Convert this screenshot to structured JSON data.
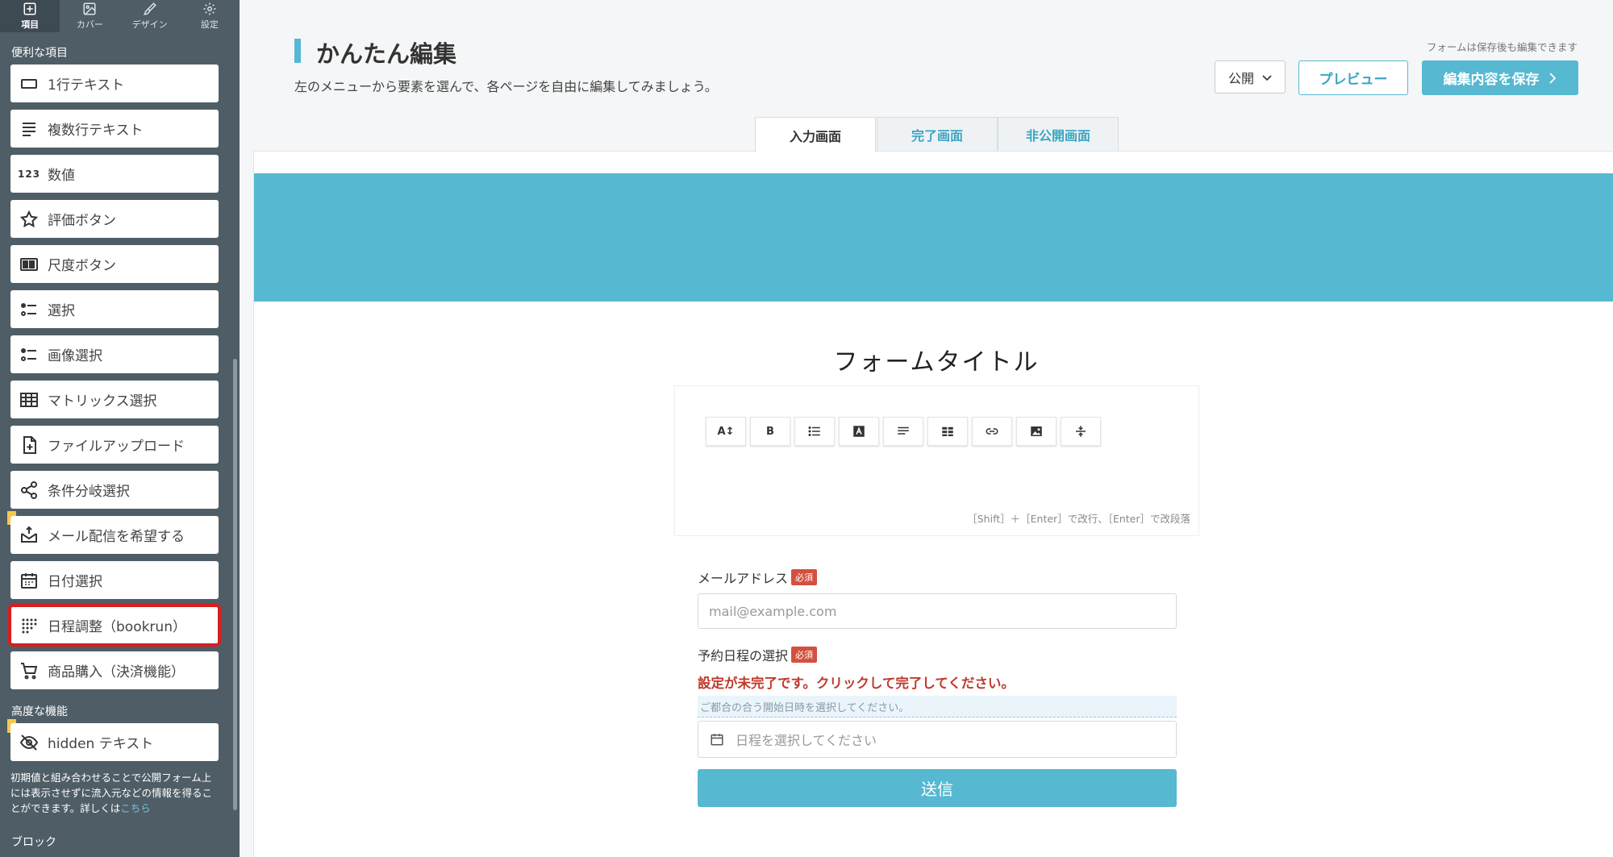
{
  "sidebar": {
    "tabs": [
      {
        "label": "項目",
        "icon": "plus-square-icon"
      },
      {
        "label": "カバー",
        "icon": "image-icon"
      },
      {
        "label": "デザイン",
        "icon": "brush-icon"
      },
      {
        "label": "設定",
        "icon": "gear-icon"
      }
    ],
    "section_convenient": "便利な項目",
    "items": [
      {
        "label": "1行テキスト",
        "icon": "single-line-icon"
      },
      {
        "label": "複数行テキスト",
        "icon": "multi-line-icon"
      },
      {
        "label": "数値",
        "icon": "number-icon",
        "icon_text": "123"
      },
      {
        "label": "評価ボタン",
        "icon": "star-icon"
      },
      {
        "label": "尺度ボタン",
        "icon": "scale-icon"
      },
      {
        "label": "選択",
        "icon": "list-select-icon"
      },
      {
        "label": "画像選択",
        "icon": "image-select-icon"
      },
      {
        "label": "マトリックス選択",
        "icon": "table-icon"
      },
      {
        "label": "ファイルアップロード",
        "icon": "file-upload-icon"
      },
      {
        "label": "条件分岐選択",
        "icon": "share-icon"
      },
      {
        "label": "メール配信を希望する",
        "icon": "mail-inbox-icon"
      },
      {
        "label": "日付選択",
        "icon": "calendar-icon"
      },
      {
        "label": "日程調整（bookrun）",
        "icon": "dot-grid-icon"
      },
      {
        "label": "商品購入（決済機能）",
        "icon": "cart-icon"
      }
    ],
    "section_advanced": "高度な機能",
    "advanced_items": [
      {
        "label": "hidden テキスト",
        "icon": "eye-off-icon"
      }
    ],
    "note_text": "初期値と組み合わせることで公開フォーム上には表示させずに流入元などの情報を得ることができます。詳しくは",
    "note_link": "こちら",
    "section_block": "ブロック"
  },
  "header": {
    "title": "かんたん編集",
    "subtitle": "左のメニューから要素を選んで、各ページを自由に編集してみましょう。",
    "save_note": "フォームは保存後も編集できます",
    "status_value": "公開",
    "preview_label": "プレビュー",
    "save_label": "編集内容を保存"
  },
  "tabs": [
    {
      "label": "入力画面"
    },
    {
      "label": "完了画面"
    },
    {
      "label": "非公開画面"
    }
  ],
  "form": {
    "title": "フォームタイトル",
    "toolbar_buttons": [
      "font-size-icon",
      "bold-icon",
      "bullet-list-icon",
      "text-color-icon",
      "align-icon",
      "table-icon",
      "link-icon",
      "image-icon",
      "divider-icon"
    ],
    "editor_hint": "［Shift］＋［Enter］で改行、［Enter］で改段落",
    "email_label": "メールアドレス",
    "required_badge": "必須",
    "email_placeholder": "mail@example.com",
    "date_label": "予約日程の選択",
    "warning": "設定が未完了です。クリックして完了してください。",
    "date_hint": "ご都合の合う開始日時を選択してください。",
    "date_placeholder": "日程を選択してください",
    "submit_label": "送信"
  },
  "colors": {
    "accent": "#56b8d1",
    "sidebar": "#4f5d66",
    "required": "#d3503f",
    "warning": "#c0392b"
  }
}
